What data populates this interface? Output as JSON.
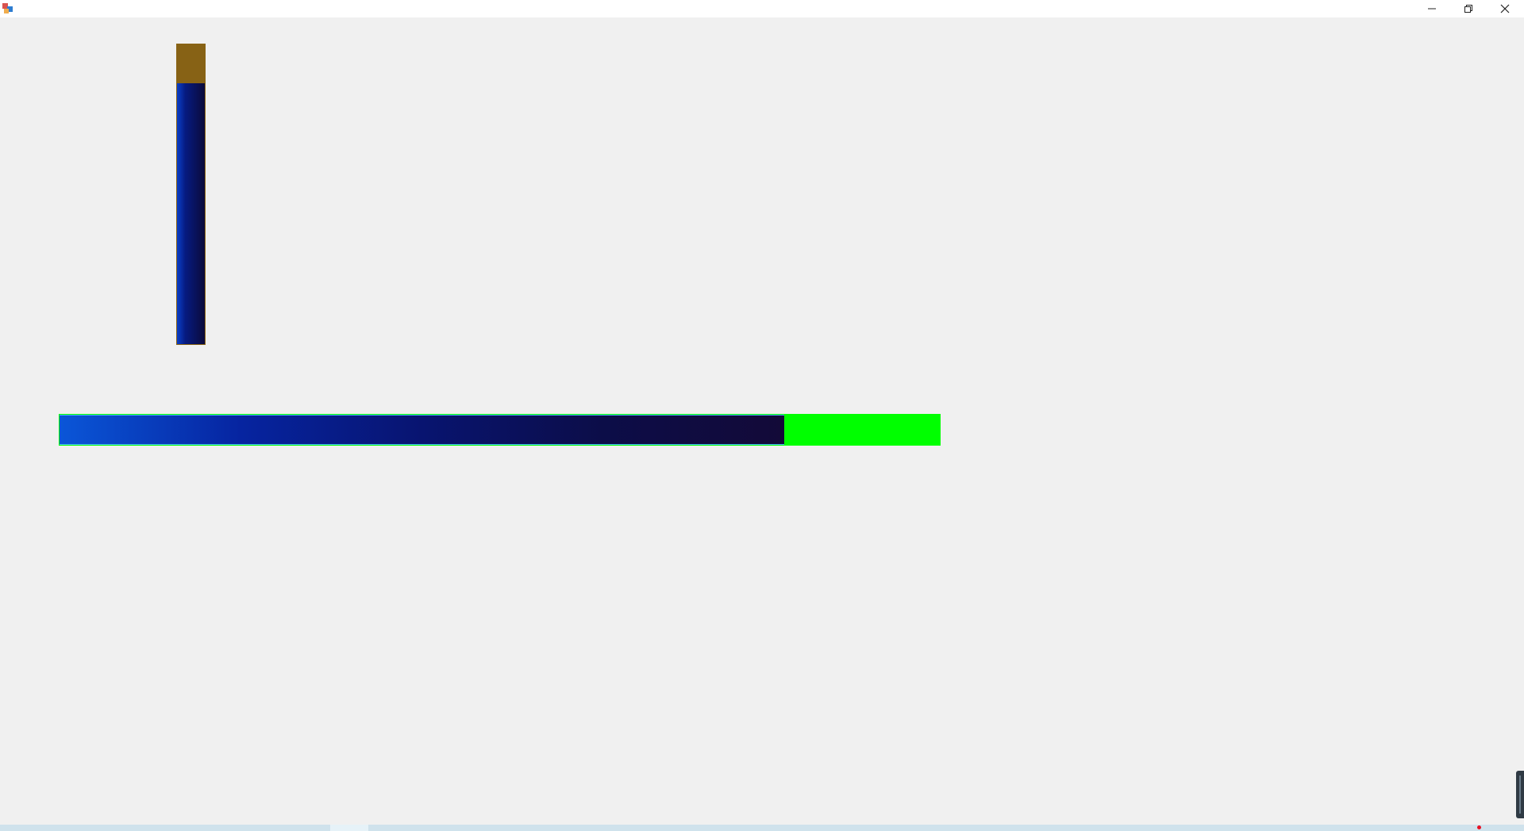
{
  "window": {
    "title": "",
    "controls": {
      "minimize_icon": "minimize-icon",
      "restore_icon": "restore-icon",
      "close_icon": "close-icon"
    }
  },
  "progress_bars": {
    "vertical": {
      "value_fraction": 0.87,
      "fill_color": "#0a2a9a",
      "remaining_color": "#876215"
    },
    "horizontal": {
      "value_fraction": 0.823,
      "fill_color": "#0a2a9a",
      "remaining_color": "#00ff00"
    }
  },
  "colors": {
    "background": "#f0f0f0",
    "titlebar": "#ffffff"
  }
}
